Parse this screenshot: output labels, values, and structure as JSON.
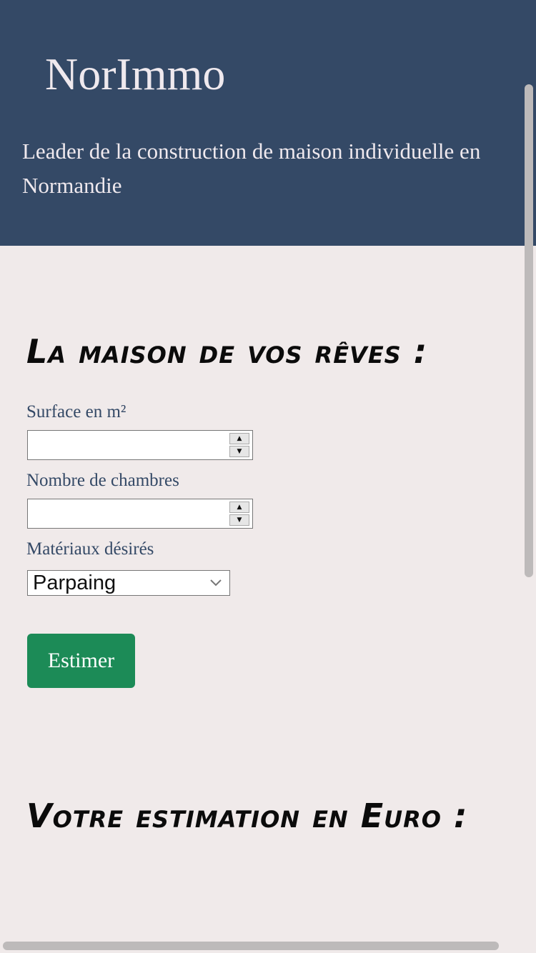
{
  "header": {
    "brand": "NorImmo",
    "tagline": "Leader de la construction de maison individuelle en Normandie"
  },
  "form": {
    "title": "La maison de vos rêves :",
    "surface_label": "Surface en m²",
    "surface_value": "",
    "rooms_label": "Nombre de chambres",
    "rooms_value": "",
    "materials_label": "Matériaux désirés",
    "materials_selected": "Parpaing",
    "submit_label": "Estimer"
  },
  "result": {
    "title": "Votre estimation en Euro :"
  },
  "icons": {
    "spin_up": "spin-up-icon",
    "spin_down": "spin-down-icon",
    "select_arrow": "chevron-down-icon"
  },
  "colors": {
    "header_bg": "#344966",
    "page_bg": "#f0eaea",
    "label_text": "#344966",
    "button_bg": "#1c8b57"
  }
}
